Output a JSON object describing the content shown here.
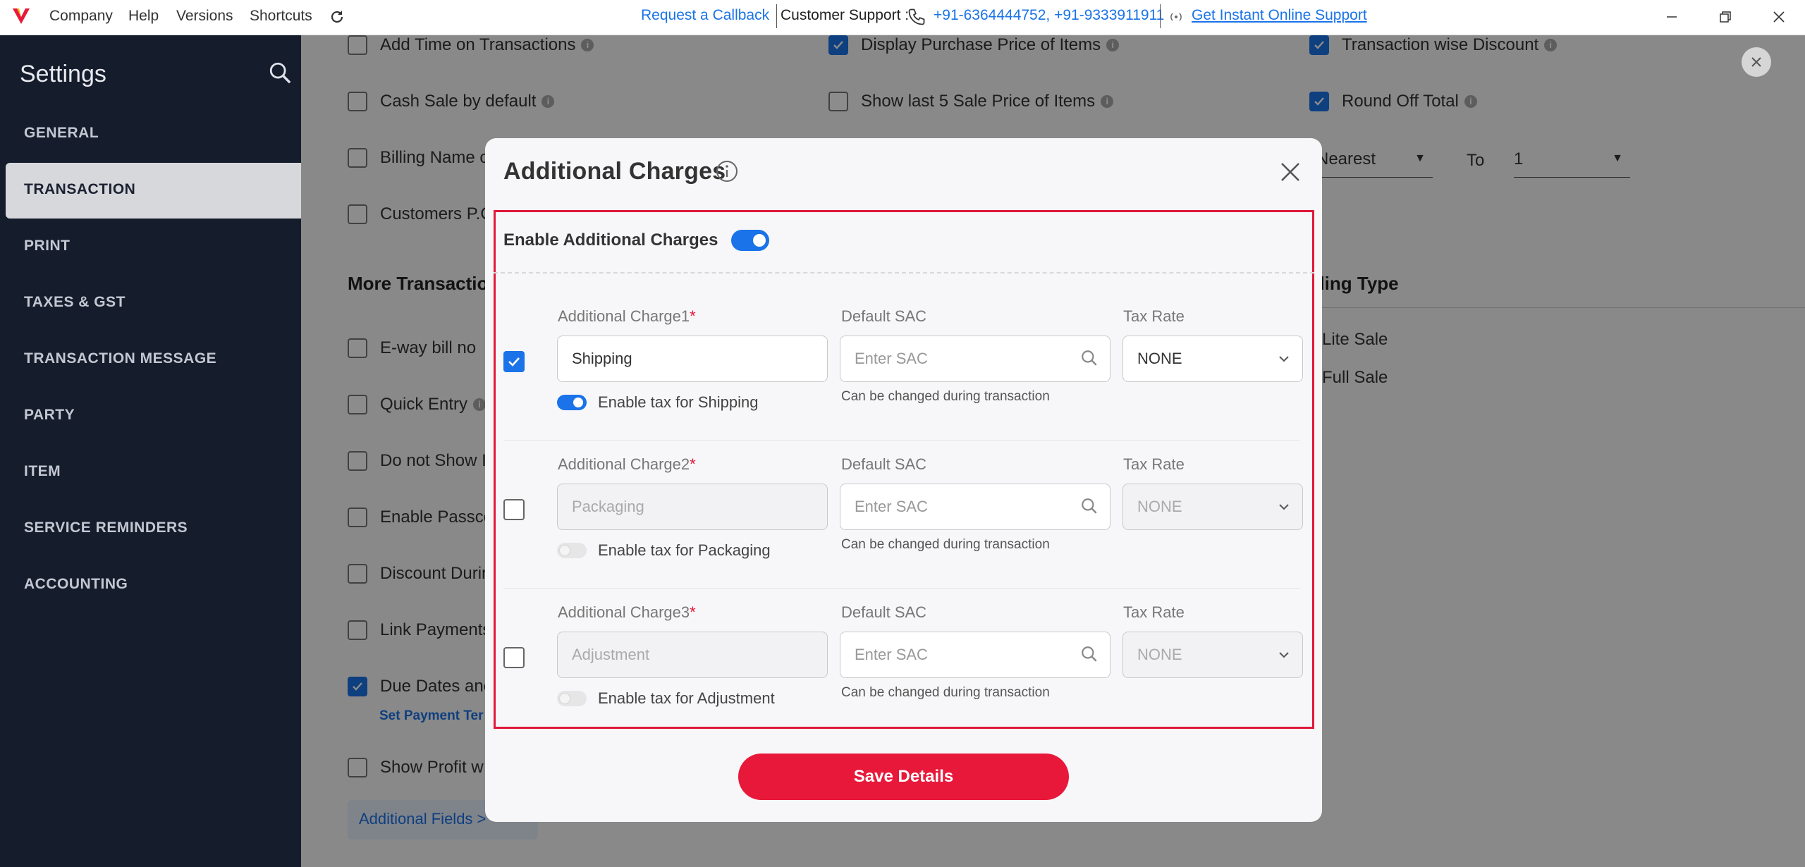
{
  "titlebar": {
    "menu": [
      "Company",
      "Help",
      "Versions",
      "Shortcuts"
    ],
    "request_callback": "Request a Callback",
    "support_label": "Customer Support :",
    "support_phones": "+91-6364444752, +91-9333911911",
    "instant_support": "Get Instant Online Support"
  },
  "sidebar": {
    "title": "Settings",
    "items": [
      "GENERAL",
      "TRANSACTION",
      "PRINT",
      "TAXES & GST",
      "TRANSACTION MESSAGE",
      "PARTY",
      "ITEM",
      "SERVICE REMINDERS",
      "ACCOUNTING"
    ],
    "active": "TRANSACTION"
  },
  "main": {
    "col1": {
      "add_time": "Add Time on Transactions",
      "cash_sale": "Cash Sale by default",
      "billing_name": "Billing Name o",
      "customers_po": "Customers P.C",
      "more_transaction": "More Transactio",
      "eway": "E-way bill no",
      "quick_entry": "Quick Entry",
      "do_not_show": "Do not Show I",
      "enable_passcode": "Enable Passco",
      "discount_during": "Discount Durin",
      "link_payments": "Link Payments",
      "due_dates": "Due Dates anc",
      "set_payment_terms": "Set Payment Ter",
      "show_profit": "Show Profit w",
      "additional_fields": "Additional Fields >"
    },
    "col2": {
      "display_purchase": "Display Purchase Price of Items",
      "show_last5": "Show last 5 Sale Price of Items"
    },
    "col3": {
      "transaction_discount": "Transaction wise Discount",
      "round_off": "Round Off Total",
      "nearest": "Nearest",
      "to_label": "To",
      "to_value": "1",
      "billing_type": "illing Type",
      "lite_sale": "Lite Sale",
      "full_sale": "Full Sale"
    }
  },
  "modal": {
    "title": "Additional Charges",
    "enable_label": "Enable Additional Charges",
    "sac_label": "Default SAC",
    "sac_placeholder": "Enter SAC",
    "sac_hint": "Can be changed during transaction",
    "tax_label": "Tax Rate",
    "rows": [
      {
        "label": "Additional Charge1",
        "required": "*",
        "value": "Shipping",
        "tax_toggle": "Enable tax for Shipping",
        "tax_rate": "NONE"
      },
      {
        "label": "Additional Charge2",
        "required": "*",
        "value": "Packaging",
        "tax_toggle": "Enable tax for Packaging",
        "tax_rate": "NONE"
      },
      {
        "label": "Additional Charge3",
        "required": "*",
        "value": "Adjustment",
        "tax_toggle": "Enable tax for Adjustment",
        "tax_rate": "NONE"
      }
    ],
    "save_label": "Save Details"
  },
  "colors": {
    "accent": "#1a73e8",
    "brand_red": "#e8183a",
    "sidebar_bg": "#151c2c",
    "highlight": "#e0193a"
  }
}
